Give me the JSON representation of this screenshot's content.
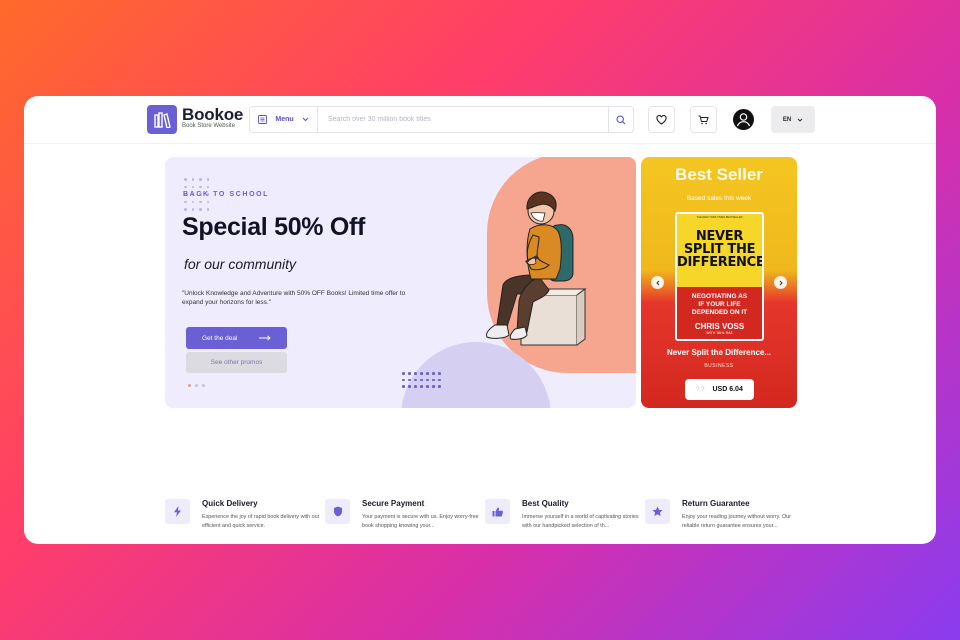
{
  "brand": {
    "name": "Bookoe",
    "tagline": "Book Store Website"
  },
  "header": {
    "menu_label": "Menu",
    "search_placeholder": "Search over 30 million book titles",
    "language": "EN"
  },
  "hero": {
    "eyebrow": "BACK TO SCHOOL",
    "headline": "Special 50% Off",
    "tagline": "for our community",
    "description": "\"Unlock Knowledge and Adventure with 50% OFF Books! Limited time offer to expand your horizons for less.\"",
    "primary_cta": "Get the deal",
    "secondary_cta": "See other promos",
    "slides": 3,
    "active_slide": 1
  },
  "best_seller": {
    "title": "Best Seller",
    "subtitle": "Based sales this week",
    "book": {
      "cover_blurb": "THE NEW YORK TIMES BESTSELLER",
      "cover_title_lines": [
        "NEVER",
        "SPLIT THE",
        "DIFFERENCE"
      ],
      "cover_subtitle_lines": [
        "NEGOTIATING AS",
        "IF YOUR LIFE",
        "DEPENDED ON IT"
      ],
      "cover_author": "CHRIS VOSS",
      "cover_coauthor": "WITH TAHL RAZ",
      "name": "Never Split the Difference...",
      "category": "BUSINESS",
      "old_price": "?.?",
      "price": "USD 6.04"
    }
  },
  "features": [
    {
      "title": "Quick Delivery",
      "text": "Experience the joy of rapid book delivery with our efficient and quick service.",
      "icon": "bolt-icon"
    },
    {
      "title": "Secure Payment",
      "text": "Your payment is secure with us. Enjoy worry-free book shopping knowing your...",
      "icon": "shield-icon"
    },
    {
      "title": "Best Quality",
      "text": "Immerse yourself in a world of captivating stories with our handpicked selection of th...",
      "icon": "thumbs-up-icon"
    },
    {
      "title": "Return Guarantee",
      "text": "Enjoy your reading journey without worry. Our reliable return guarantee ensures your...",
      "icon": "star-icon"
    }
  ],
  "colors": {
    "accent": "#6b5fd6",
    "peach": "#f6a58f",
    "hero_bg": "#eeecfd"
  }
}
